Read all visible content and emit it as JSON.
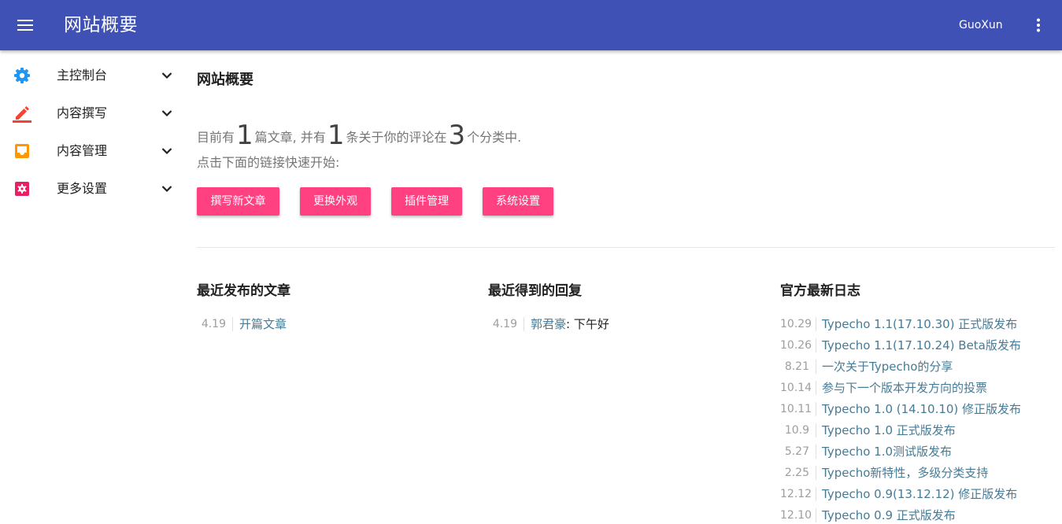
{
  "appbar": {
    "title": "网站概要",
    "user": "GuoXun",
    "menu_icon": "menu-icon",
    "more_icon": "more-vert-icon",
    "color": "#3f51b5"
  },
  "sidebar": {
    "items": [
      {
        "label": "主控制台",
        "icon": "gear-icon",
        "icon_color": "#2196f3"
      },
      {
        "label": "内容撰写",
        "icon": "pencil-icon",
        "icon_color": "#f44336"
      },
      {
        "label": "内容管理",
        "icon": "inbox-icon",
        "icon_color": "#ff9800"
      },
      {
        "label": "更多设置",
        "icon": "settings-box-icon",
        "icon_color": "#e91e63"
      }
    ]
  },
  "main": {
    "title": "网站概要",
    "summary": {
      "t1": "目前有",
      "posts": "1",
      "t2": "篇文章, 并有",
      "comments": "1",
      "t3": "条关于你的评论在",
      "categories": "3",
      "t4": "个分类中."
    },
    "hint": "点击下面的链接快速开始:",
    "buttons": [
      "撰写新文章",
      "更换外观",
      "插件管理",
      "系统设置"
    ],
    "accent_color": "#ff4081",
    "recent_posts": {
      "title": "最近发布的文章",
      "items": [
        {
          "date": "4.19",
          "text": "开篇文章"
        }
      ]
    },
    "recent_replies": {
      "title": "最近得到的回复",
      "items": [
        {
          "date": "4.19",
          "author": "郭君豪",
          "text": ": 下午好"
        }
      ]
    },
    "official_logs": {
      "title": "官方最新日志",
      "items": [
        {
          "date": "10.29",
          "text": "Typecho 1.1(17.10.30) 正式版发布"
        },
        {
          "date": "10.26",
          "text": "Typecho 1.1(17.10.24) Beta版发布"
        },
        {
          "date": "8.21",
          "text": "一次关于Typecho的分享"
        },
        {
          "date": "10.14",
          "text": "参与下一个版本开发方向的投票"
        },
        {
          "date": "10.11",
          "text": "Typecho 1.0 (14.10.10) 修正版发布"
        },
        {
          "date": "10.9",
          "text": "Typecho 1.0 正式版发布"
        },
        {
          "date": "5.27",
          "text": "Typecho 1.0测试版发布"
        },
        {
          "date": "2.25",
          "text": "Typecho新特性，多级分类支持"
        },
        {
          "date": "12.12",
          "text": "Typecho 0.9(13.12.12) 修正版发布"
        },
        {
          "date": "12.10",
          "text": "Typecho 0.9 正式版发布"
        }
      ]
    }
  }
}
